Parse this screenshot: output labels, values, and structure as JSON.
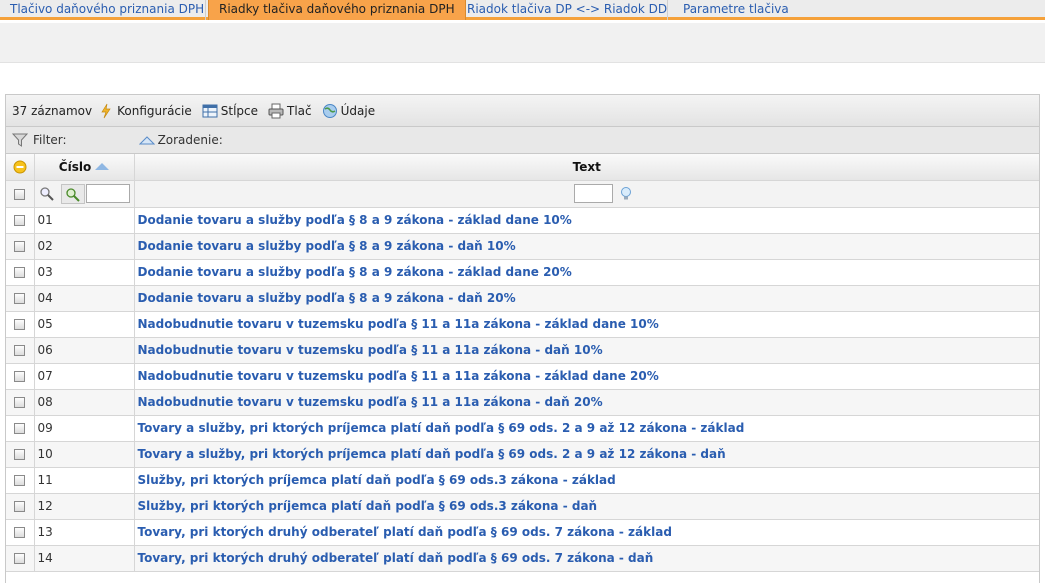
{
  "tabs": [
    {
      "label": "Tlačivo daňového priznania DPH",
      "active": false
    },
    {
      "label": "Riadky tlačiva daňového priznania DPH",
      "active": true
    },
    {
      "label": "Riadok tlačiva DP <-> Riadok DD",
      "active": false
    },
    {
      "label": "Parametre tlačiva",
      "active": false
    }
  ],
  "toolbar": {
    "record_count": "37 záznamov",
    "config_label": "Konfigurácie",
    "columns_label": "Stĺpce",
    "print_label": "Tlač",
    "data_label": "Údaje"
  },
  "filterbar": {
    "filter_label": "Filter:",
    "sort_label": "Zoradenie:"
  },
  "columns": {
    "number": "Číslo",
    "text": "Text"
  },
  "filter_inputs": {
    "number_value": "",
    "text_value": ""
  },
  "icons": {
    "config": "lightning-icon",
    "columns": "columns-icon",
    "print": "printer-icon",
    "data": "globe-icon",
    "filter": "funnel-icon",
    "sort": "sort-asc-icon",
    "select_all": "minus-circle-icon",
    "search": "magnifier-icon",
    "search_add": "magnifier-plus-icon",
    "hint": "lightbulb-icon"
  },
  "colors": {
    "tab_accent": "#f8a34a",
    "link": "#2a5db0"
  },
  "rows": [
    {
      "number": "01",
      "text": "Dodanie tovaru a služby podľa § 8 a 9 zákona - základ dane 10%"
    },
    {
      "number": "02",
      "text": "Dodanie tovaru a služby podľa § 8 a 9 zákona - daň 10%"
    },
    {
      "number": "03",
      "text": "Dodanie tovaru a služby podľa § 8 a 9 zákona - základ dane 20%"
    },
    {
      "number": "04",
      "text": "Dodanie tovaru a služby podľa § 8 a 9 zákona - daň 20%"
    },
    {
      "number": "05",
      "text": "Nadobudnutie tovaru v tuzemsku podľa § 11 a 11a zákona - základ dane 10%"
    },
    {
      "number": "06",
      "text": "Nadobudnutie tovaru v tuzemsku podľa § 11 a 11a zákona - daň 10%"
    },
    {
      "number": "07",
      "text": "Nadobudnutie tovaru v tuzemsku podľa § 11 a 11a zákona - základ dane 20%"
    },
    {
      "number": "08",
      "text": "Nadobudnutie tovaru v tuzemsku podľa § 11 a 11a zákona - daň 20%"
    },
    {
      "number": "09",
      "text": "Tovary a služby, pri ktorých príjemca platí daň podľa § 69 ods. 2 a 9 až 12 zákona - základ"
    },
    {
      "number": "10",
      "text": "Tovary a služby, pri ktorých príjemca platí daň podľa § 69 ods. 2 a 9 až 12 zákona - daň"
    },
    {
      "number": "11",
      "text": "Služby, pri ktorých príjemca platí daň podľa § 69 ods.3 zákona - základ"
    },
    {
      "number": "12",
      "text": "Služby, pri ktorých príjemca platí daň podľa § 69 ods.3 zákona - daň"
    },
    {
      "number": "13",
      "text": "Tovary, pri ktorých druhý odberateľ platí daň podľa § 69 ods. 7 zákona - základ"
    },
    {
      "number": "14",
      "text": "Tovary, pri ktorých druhý odberateľ platí daň podľa § 69 ods. 7 zákona - daň"
    }
  ]
}
